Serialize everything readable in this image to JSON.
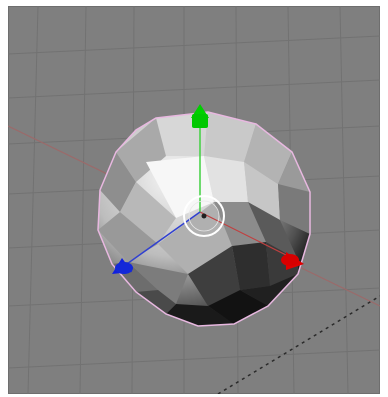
{
  "app": {
    "title": ""
  },
  "viewport": {
    "background_color": "#7f7f7f",
    "grid_color": "#707070",
    "x_axis_color": "#9b6a6a",
    "selection_outline_color": "#e8b8e0"
  },
  "gizmo": {
    "x_axis_color": "#e00000",
    "y_axis_color": "#00d000",
    "z_axis_color": "#1020e0",
    "center_circle_color": "#ffffff"
  },
  "object": {
    "type": "icosphere",
    "selected": true
  }
}
